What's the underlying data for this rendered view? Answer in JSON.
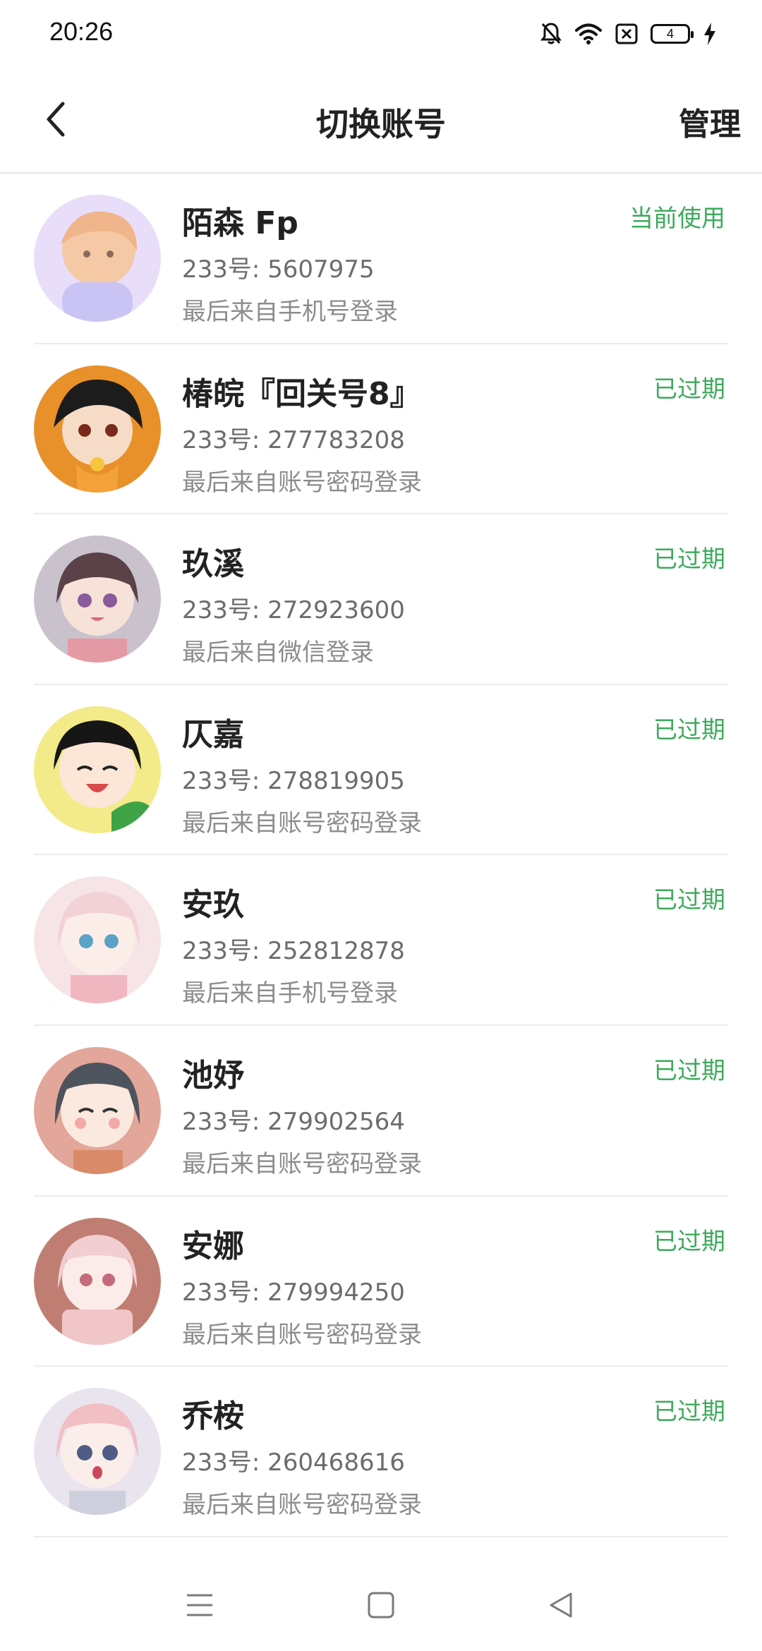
{
  "status_bar": {
    "time": "20:26",
    "battery_level": "4",
    "icons": [
      "bell-off-icon",
      "wifi-icon",
      "sim-error-icon",
      "battery-icon",
      "charging-icon"
    ]
  },
  "header": {
    "title": "切换账号",
    "manage_label": "管理",
    "back_icon": "chevron-left-icon"
  },
  "colors": {
    "status_green": "#3daa5c",
    "divider": "#ececec",
    "title_text": "#222222",
    "secondary_text": "#6c6c6c"
  },
  "accounts": [
    {
      "name": "陌森 Fp",
      "id_text": "233号: 5607975",
      "login_text": "最后来自手机号登录",
      "status": "当前使用"
    },
    {
      "name": "椿皖『回关号8』",
      "id_text": "233号: 277783208",
      "login_text": "最后来自账号密码登录",
      "status": "已过期"
    },
    {
      "name": "玖溪",
      "id_text": "233号: 272923600",
      "login_text": "最后来自微信登录",
      "status": "已过期"
    },
    {
      "name": "仄嘉",
      "id_text": "233号: 278819905",
      "login_text": "最后来自账号密码登录",
      "status": "已过期"
    },
    {
      "name": "安玖",
      "id_text": "233号: 252812878",
      "login_text": "最后来自手机号登录",
      "status": "已过期"
    },
    {
      "name": "池妤",
      "id_text": "233号: 279902564",
      "login_text": "最后来自账号密码登录",
      "status": "已过期"
    },
    {
      "name": "安娜",
      "id_text": "233号: 279994250",
      "login_text": "最后来自账号密码登录",
      "status": "已过期"
    },
    {
      "name": "乔桉",
      "id_text": "233号: 260468616",
      "login_text": "最后来自账号密码登录",
      "status": "已过期"
    }
  ],
  "nav_bar": {
    "icons": [
      "menu-icon",
      "home-icon",
      "back-triangle-icon"
    ]
  }
}
